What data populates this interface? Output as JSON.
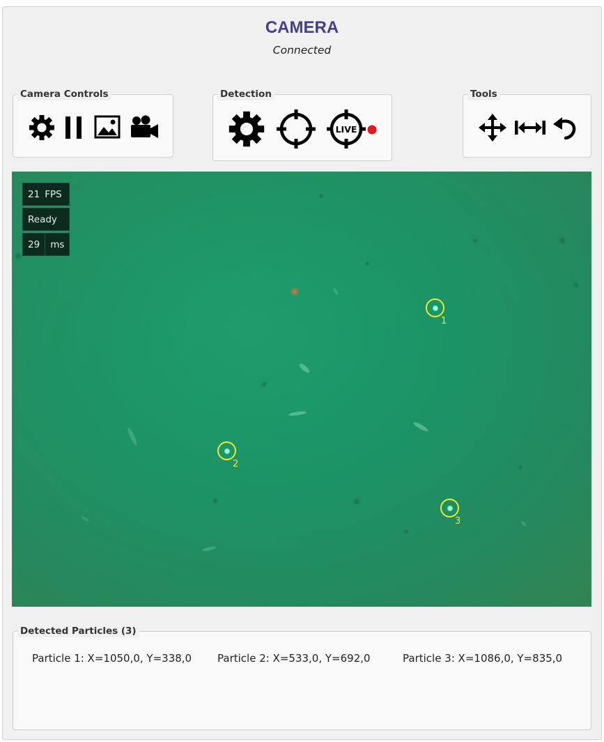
{
  "header": {
    "title": "CAMERA",
    "status": "Connected",
    "title_color": "#483d8b"
  },
  "camera_controls": {
    "label": "Camera Controls",
    "buttons": [
      {
        "icon": "gear-icon"
      },
      {
        "icon": "pause-icon"
      },
      {
        "icon": "image-icon"
      },
      {
        "icon": "video-camera-icon"
      }
    ]
  },
  "detection": {
    "label": "Detection",
    "buttons": [
      {
        "icon": "gear-icon"
      },
      {
        "icon": "crosshair-icon"
      },
      {
        "icon": "crosshair-live-icon",
        "text": "LIVE"
      }
    ],
    "live_indicator_color": "#e8141e"
  },
  "tools": {
    "label": "Tools",
    "buttons": [
      {
        "icon": "move-arrows-icon"
      },
      {
        "icon": "horizontal-fit-icon"
      },
      {
        "icon": "undo-icon"
      }
    ]
  },
  "viewer": {
    "fps_value": "21",
    "fps_unit": "FPS",
    "state": "Ready",
    "latency_value": "29",
    "latency_unit": "ms",
    "background_color": "#1a9367",
    "marker_color": "#f0ea2a",
    "markers": [
      {
        "label": "1"
      },
      {
        "label": "2"
      },
      {
        "label": "3"
      }
    ]
  },
  "particles": {
    "label": "Detected Particles (3)",
    "items": [
      {
        "text": "Particle 1: X=1050,0, Y=338,0"
      },
      {
        "text": "Particle 2: X=533,0, Y=692,0"
      },
      {
        "text": "Particle 3: X=1086,0, Y=835,0"
      }
    ]
  }
}
